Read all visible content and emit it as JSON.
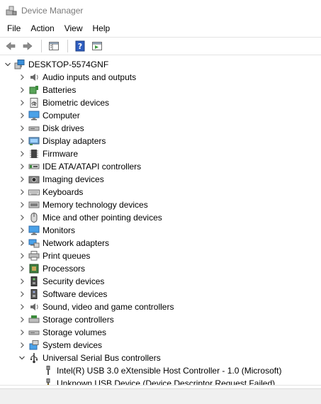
{
  "window": {
    "title": "Device Manager"
  },
  "menu": [
    {
      "label": "File"
    },
    {
      "label": "Action"
    },
    {
      "label": "View"
    },
    {
      "label": "Help"
    }
  ],
  "toolbar": {
    "items": [
      "back-arrow-icon",
      "forward-arrow-icon",
      "properties-view-icon",
      "help-icon",
      "run-icon"
    ]
  },
  "tree": {
    "root": {
      "label": "DESKTOP-5574GNF",
      "icon": "computer-monitor-icon",
      "expanded": true
    },
    "categories": [
      {
        "label": "Audio inputs and outputs",
        "icon": "speaker-icon"
      },
      {
        "label": "Batteries",
        "icon": "battery-icon"
      },
      {
        "label": "Biometric devices",
        "icon": "fingerprint-icon"
      },
      {
        "label": "Computer",
        "icon": "computer-icon"
      },
      {
        "label": "Disk drives",
        "icon": "disk-drive-icon"
      },
      {
        "label": "Display adapters",
        "icon": "display-adapter-icon"
      },
      {
        "label": "Firmware",
        "icon": "chip-icon"
      },
      {
        "label": "IDE ATA/ATAPI controllers",
        "icon": "ide-controller-icon"
      },
      {
        "label": "Imaging devices",
        "icon": "camera-icon"
      },
      {
        "label": "Keyboards",
        "icon": "keyboard-icon"
      },
      {
        "label": "Memory technology devices",
        "icon": "memory-icon"
      },
      {
        "label": "Mice and other pointing devices",
        "icon": "mouse-icon"
      },
      {
        "label": "Monitors",
        "icon": "monitor-icon"
      },
      {
        "label": "Network adapters",
        "icon": "network-adapter-icon"
      },
      {
        "label": "Print queues",
        "icon": "printer-icon"
      },
      {
        "label": "Processors",
        "icon": "processor-icon"
      },
      {
        "label": "Security devices",
        "icon": "security-device-icon"
      },
      {
        "label": "Software devices",
        "icon": "software-device-icon"
      },
      {
        "label": "Sound, video and game controllers",
        "icon": "sound-icon"
      },
      {
        "label": "Storage controllers",
        "icon": "storage-controller-icon"
      },
      {
        "label": "Storage volumes",
        "icon": "storage-volume-icon"
      },
      {
        "label": "System devices",
        "icon": "system-device-icon"
      },
      {
        "label": "Universal Serial Bus controllers",
        "icon": "usb-icon",
        "expanded": true,
        "children": [
          {
            "label": "Intel(R) USB 3.0 eXtensible Host Controller - 1.0 (Microsoft)",
            "icon": "usb-plug-icon"
          },
          {
            "label": "Unknown USB Device (Device Descriptor Request Failed)",
            "icon": "usb-warning-icon"
          }
        ]
      }
    ]
  },
  "colors": {
    "accent": "#0078d7",
    "border": "#e3e3e3",
    "status_bg": "#f0f0f0"
  }
}
